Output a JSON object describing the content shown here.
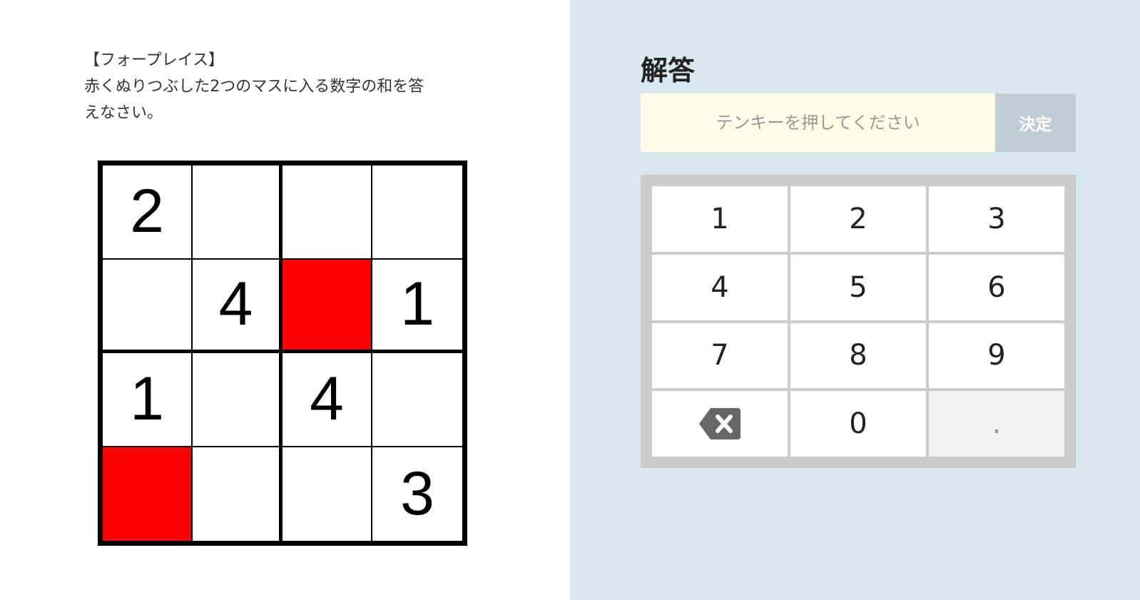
{
  "question": {
    "title": "【フォープレイス】",
    "line1": "赤くぬりつぶした2つのマスに入る数字の和を答",
    "line2": "えなさい。"
  },
  "puzzle": {
    "cells": [
      [
        "2",
        "",
        "",
        ""
      ],
      [
        "",
        "4",
        "",
        "1"
      ],
      [
        "1",
        "",
        "4",
        ""
      ],
      [
        "",
        "",
        "",
        "3"
      ]
    ],
    "highlighted_color": "#ff0000",
    "highlighted": [
      [
        1,
        2
      ],
      [
        3,
        0
      ]
    ]
  },
  "answer": {
    "title": "解答",
    "input_placeholder": "テンキーを押してください",
    "input_value": "",
    "submit_label": "決定"
  },
  "keypad": {
    "keys": [
      "1",
      "2",
      "3",
      "4",
      "5",
      "6",
      "7",
      "8",
      "9",
      "backspace",
      "0",
      "."
    ]
  },
  "colors": {
    "right_background": "#d7e8ef",
    "input_background": "#fefce6",
    "submit_background": "#bfcdd4",
    "keypad_frame": "#cccccc"
  }
}
